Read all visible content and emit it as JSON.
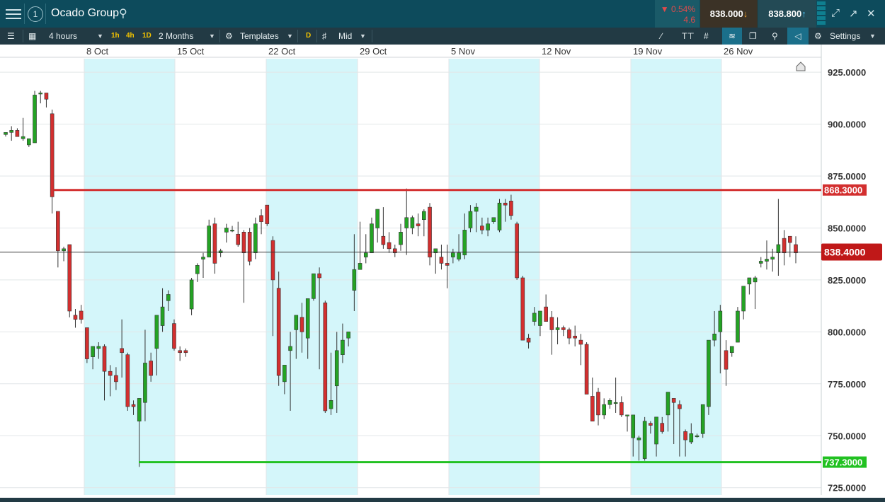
{
  "header": {
    "instrument": "Ocado Group",
    "change_pct": "▼ 0.54%",
    "change_abs": "4.6",
    "sell_price": "838.000",
    "buy_price": "838.800"
  },
  "toolbar": {
    "interval": "4 hours",
    "quick_intervals": [
      "1h",
      "4h",
      "1D"
    ],
    "range": "2 Months",
    "templates": "Templates",
    "drawing_mode": "D",
    "price_type": "Mid",
    "settings": "Settings"
  },
  "chart_data": {
    "type": "candlestick",
    "x_tick_labels": [
      "8 Oct",
      "15 Oct",
      "22 Oct",
      "29 Oct",
      "5 Nov",
      "12 Nov",
      "19 Nov",
      "26 Nov"
    ],
    "y_tick_labels": [
      "925.0000",
      "900.0000",
      "875.0000",
      "850.0000",
      "825.0000",
      "800.0000",
      "775.0000",
      "750.0000",
      "725.0000"
    ],
    "ylim": [
      721.5,
      931.5
    ],
    "resistance_line": {
      "value": 868.3,
      "label": "868.3000",
      "color": "#d32f2f"
    },
    "support_line": {
      "value": 737.3,
      "label": "737.3000",
      "color": "#21c121"
    },
    "current_price": {
      "value": 838.4,
      "label": "838.4000",
      "color": "#c01818"
    },
    "up_color": "#24a324",
    "down_color": "#d32f2f",
    "candles": [
      [
        895,
        896,
        894,
        896
      ],
      [
        896,
        899,
        892,
        897
      ],
      [
        897,
        898,
        894,
        894
      ],
      [
        893,
        903,
        892,
        894
      ],
      [
        890,
        893,
        889,
        893
      ],
      [
        891,
        916,
        891,
        914
      ],
      [
        915,
        916,
        910,
        915
      ],
      [
        915,
        915,
        908,
        912
      ],
      [
        905,
        907,
        857,
        865
      ],
      [
        858,
        858,
        831,
        839
      ],
      [
        839,
        841,
        834,
        840
      ],
      [
        842,
        842,
        807,
        810
      ],
      [
        808,
        811,
        802,
        806
      ],
      [
        810,
        813,
        804,
        806
      ],
      [
        802,
        802,
        785,
        787
      ],
      [
        788,
        793,
        782,
        793
      ],
      [
        792,
        795,
        787,
        793
      ],
      [
        793,
        794,
        767,
        781
      ],
      [
        781,
        784,
        769,
        779
      ],
      [
        779,
        783,
        772,
        776
      ],
      [
        792,
        806,
        778,
        790
      ],
      [
        789,
        790,
        762,
        764
      ],
      [
        765,
        767,
        760,
        764
      ],
      [
        757,
        767,
        735,
        768
      ],
      [
        766,
        801,
        757,
        785
      ],
      [
        786,
        790,
        776,
        779
      ],
      [
        792,
        807,
        779,
        808
      ],
      [
        803,
        821,
        800,
        812
      ],
      [
        815,
        820,
        810,
        818
      ],
      [
        804,
        806,
        791,
        792
      ],
      [
        791,
        793,
        786,
        790
      ],
      [
        791,
        792,
        788,
        790
      ],
      [
        811,
        826,
        808,
        825
      ],
      [
        828,
        833,
        824,
        832
      ],
      [
        835,
        838,
        826,
        836
      ],
      [
        836,
        854,
        836,
        851
      ],
      [
        852,
        855,
        828,
        833
      ],
      [
        838,
        840,
        836,
        839
      ],
      [
        848,
        852,
        843,
        850
      ],
      [
        849,
        851,
        848,
        849
      ],
      [
        847,
        853,
        841,
        842
      ],
      [
        848,
        849,
        814,
        838
      ],
      [
        848,
        850,
        832,
        834
      ],
      [
        838,
        855,
        835,
        852
      ],
      [
        856,
        859,
        847,
        853
      ],
      [
        861,
        861,
        851,
        852
      ],
      [
        844,
        846,
        798,
        825
      ],
      [
        821,
        829,
        774,
        779
      ],
      [
        776,
        781,
        770,
        784
      ],
      [
        791,
        800,
        762,
        793
      ],
      [
        801,
        807,
        787,
        808
      ],
      [
        807,
        814,
        790,
        800
      ],
      [
        797,
        807,
        787,
        816
      ],
      [
        816,
        825,
        815,
        828
      ],
      [
        828,
        831,
        782,
        826
      ],
      [
        814,
        815,
        761,
        762
      ],
      [
        763,
        790,
        760,
        767
      ],
      [
        774,
        800,
        761,
        791
      ],
      [
        789,
        804,
        785,
        796
      ],
      [
        797,
        798,
        793,
        800
      ],
      [
        820,
        847,
        810,
        830
      ],
      [
        830,
        853,
        831,
        833
      ],
      [
        836,
        847,
        833,
        838
      ],
      [
        838,
        855,
        845,
        852
      ],
      [
        850,
        857,
        843,
        859
      ],
      [
        846,
        860,
        840,
        842
      ],
      [
        843,
        848,
        838,
        840
      ],
      [
        840,
        842,
        836,
        838
      ],
      [
        842,
        852,
        839,
        848
      ],
      [
        850,
        869,
        837,
        855
      ],
      [
        850,
        856,
        847,
        855
      ],
      [
        852,
        857,
        846,
        851
      ],
      [
        854,
        859,
        846,
        858
      ],
      [
        860,
        862,
        832,
        836
      ],
      [
        838,
        840,
        828,
        840
      ],
      [
        836,
        842,
        830,
        833
      ],
      [
        833,
        842,
        821,
        832
      ],
      [
        836,
        840,
        833,
        838
      ],
      [
        835,
        847,
        834,
        838
      ],
      [
        837,
        857,
        835,
        849
      ],
      [
        850,
        861,
        848,
        858
      ],
      [
        858,
        862,
        848,
        860
      ],
      [
        851,
        855,
        847,
        849
      ],
      [
        849,
        855,
        846,
        852
      ],
      [
        853,
        855,
        852,
        855
      ],
      [
        849,
        864,
        848,
        862
      ],
      [
        862,
        864,
        853,
        861
      ],
      [
        863,
        866,
        854,
        856
      ],
      [
        852,
        853,
        825,
        826
      ],
      [
        826,
        827,
        796,
        796
      ],
      [
        797,
        799,
        792,
        795
      ],
      [
        805,
        812,
        803,
        809
      ],
      [
        803,
        806,
        798,
        810
      ],
      [
        812,
        818,
        805,
        805
      ],
      [
        807,
        810,
        789,
        801
      ],
      [
        801,
        807,
        794,
        802
      ],
      [
        802,
        803,
        798,
        801
      ],
      [
        801,
        802,
        794,
        797
      ],
      [
        798,
        803,
        793,
        797
      ],
      [
        796,
        799,
        784,
        794
      ],
      [
        794,
        795,
        780,
        770
      ],
      [
        769,
        778,
        763,
        757
      ],
      [
        771,
        773,
        755,
        760
      ],
      [
        760,
        768,
        758,
        765
      ],
      [
        765,
        768,
        763,
        767
      ],
      [
        766,
        778,
        761,
        766
      ],
      [
        766,
        769,
        759,
        760
      ],
      [
        760,
        760,
        752,
        760
      ],
      [
        749,
        752,
        740,
        760
      ],
      [
        748,
        750,
        738,
        749
      ],
      [
        739,
        759,
        738,
        757
      ],
      [
        756,
        757,
        751,
        755
      ],
      [
        746,
        752,
        740,
        759
      ],
      [
        756,
        759,
        751,
        752
      ],
      [
        760,
        771,
        752,
        771
      ],
      [
        768,
        768,
        746,
        766
      ],
      [
        765,
        767,
        740,
        763
      ],
      [
        752,
        753,
        740,
        748
      ],
      [
        747,
        756,
        746,
        751
      ],
      [
        750,
        751,
        749,
        750
      ],
      [
        751,
        765,
        749,
        765
      ],
      [
        764,
        795,
        760,
        796
      ],
      [
        796,
        810,
        793,
        799
      ],
      [
        800,
        813,
        780,
        810
      ],
      [
        791,
        796,
        774,
        782
      ],
      [
        790,
        792,
        788,
        793
      ],
      [
        795,
        812,
        795,
        810
      ],
      [
        810,
        819,
        806,
        822
      ],
      [
        823,
        826,
        818,
        826
      ],
      [
        824,
        827,
        811,
        826
      ],
      [
        833,
        836,
        831,
        834
      ],
      [
        834,
        844,
        830,
        835
      ],
      [
        835,
        840,
        829,
        836
      ],
      [
        838,
        864,
        827,
        842
      ],
      [
        845,
        849,
        832,
        838
      ],
      [
        846,
        846,
        836,
        843
      ],
      [
        842,
        846,
        833,
        838
      ]
    ]
  }
}
